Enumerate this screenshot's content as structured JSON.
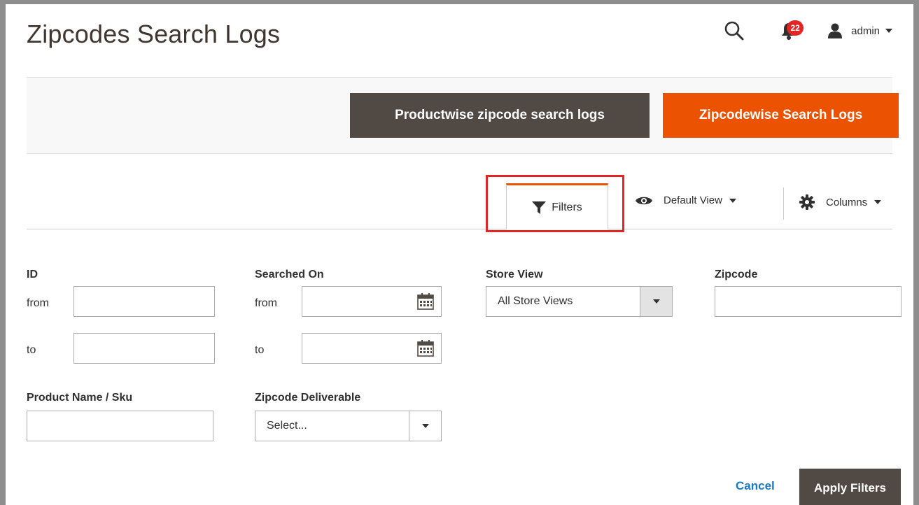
{
  "header": {
    "title": "Zipcodes Search Logs",
    "notifications_count": "22",
    "user_name": "admin"
  },
  "action_bar": {
    "productwise_label": "Productwise zipcode search logs",
    "zipcodewise_label": "Zipcodewise Search Logs"
  },
  "toolbar": {
    "filters_label": "Filters",
    "view_label": "Default View",
    "columns_label": "Columns"
  },
  "filters": {
    "id_label": "ID",
    "id_from": "from",
    "id_to": "to",
    "searched_on_label": "Searched On",
    "searched_from": "from",
    "searched_to": "to",
    "store_view_label": "Store View",
    "store_view_value": "All Store Views",
    "zipcode_label": "Zipcode",
    "product_label": "Product Name / Sku",
    "deliverable_label": "Zipcode Deliverable",
    "deliverable_value": "Select..."
  },
  "footer": {
    "cancel_label": "Cancel",
    "apply_label": "Apply Filters"
  },
  "colors": {
    "accent": "#eb5202",
    "dark_button": "#514943",
    "link": "#1979c3",
    "badge": "#e22626"
  }
}
